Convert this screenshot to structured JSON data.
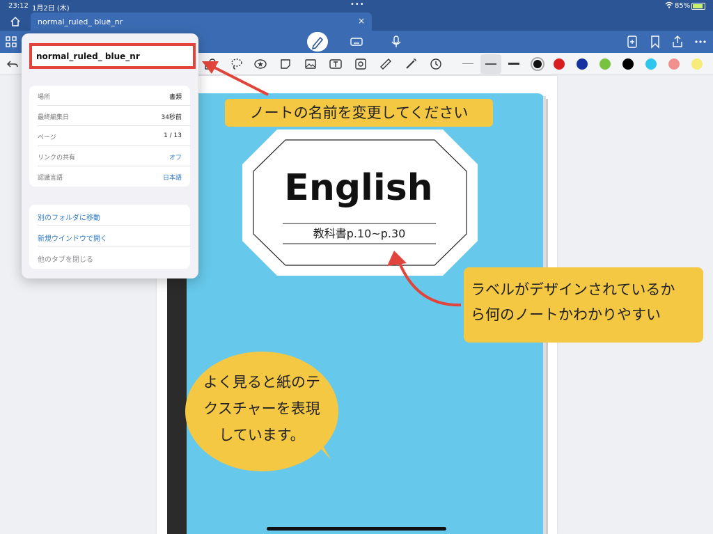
{
  "status_bar": {
    "time": "23:12",
    "date": "1月2日 (木)",
    "battery_text": "85%",
    "battery_level": 0.85
  },
  "tab": {
    "title": "normal_ruled_ blue_nr"
  },
  "popover": {
    "name_value": "normal_ruled_ blue_nr",
    "info": [
      {
        "key": "場所",
        "value": "書類"
      },
      {
        "key": "最終編集日",
        "value": "34秒前"
      },
      {
        "key": "ページ",
        "value": "1 / 13"
      },
      {
        "key": "リンクの共有",
        "value": "オフ"
      },
      {
        "key": "認識言語",
        "value": "日本語"
      }
    ],
    "actions": [
      {
        "label": "別のフォルダに移動"
      },
      {
        "label": "新規ウインドウで開く"
      },
      {
        "label": "他のタブを閉じる"
      }
    ]
  },
  "notebook": {
    "label_title": "English",
    "label_subtitle": "教科書p.10~p.30",
    "cover_color": "#66c8ea"
  },
  "annotations": {
    "top": "ノートの名前を変更してください",
    "right_line1": "ラベルがデザインされているか",
    "right_line2": "ら何のノートかわかりやすい",
    "bubble_line1": "よく見ると紙のテ",
    "bubble_line2": "クスチャーを表現",
    "bubble_line3": "しています。"
  },
  "colors": {
    "header_blue": "#2c5595",
    "toolbar_blue": "#3b6cb3",
    "highlight_red": "#e0443a",
    "callout_yellow": "#f4c842"
  },
  "palette": [
    "#111111",
    "#d81e1e",
    "#1532a0",
    "#79c240",
    "#000000",
    "#2fc6ee",
    "#f28f8f",
    "#f6ec7a"
  ],
  "icons": {
    "toolbar_top": [
      "grid-icon",
      "pen-icon",
      "keyboard-icon",
      "microphone-icon",
      "add-page-icon",
      "bookmark-icon",
      "share-icon",
      "more-icon"
    ],
    "toolbar_tools": [
      "undo-icon",
      "shapes-icon",
      "lasso-icon",
      "star-icon",
      "sticker-icon",
      "image-icon",
      "text-icon",
      "camera-icon",
      "ruler-icon",
      "laser-icon",
      "clock-icon"
    ]
  }
}
